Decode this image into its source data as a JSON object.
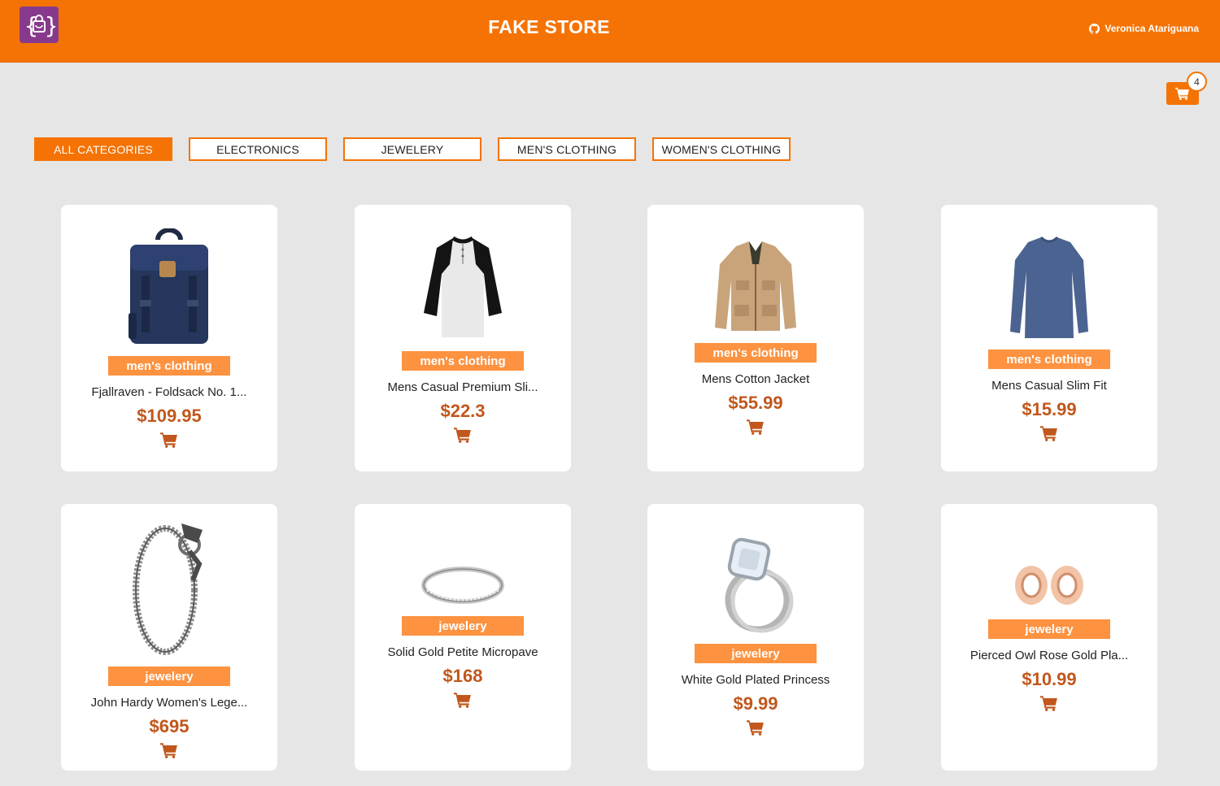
{
  "header": {
    "title": "FAKE STORE",
    "user_name": "Veronica Atariguana",
    "brand_color": "#f57304",
    "logo_color": "#873a8c"
  },
  "cart": {
    "count": "4"
  },
  "categories": [
    {
      "label": "ALL CATEGORIES",
      "active": true
    },
    {
      "label": "ELECTRONICS",
      "active": false
    },
    {
      "label": "JEWELERY",
      "active": false
    },
    {
      "label": "MEN'S CLOTHING",
      "active": false
    },
    {
      "label": "WOMEN'S CLOTHING",
      "active": false
    }
  ],
  "products": [
    {
      "category": "men's clothing",
      "title": "Fjallraven - Foldsack No. 1...",
      "price": "$109.95",
      "image": "backpack"
    },
    {
      "category": "men's clothing",
      "title": "Mens Casual Premium Sli...",
      "price": "$22.3",
      "image": "raglan-shirt"
    },
    {
      "category": "men's clothing",
      "title": "Mens Cotton Jacket",
      "price": "$55.99",
      "image": "jacket"
    },
    {
      "category": "men's clothing",
      "title": "Mens Casual Slim Fit",
      "price": "$15.99",
      "image": "longsleeve-shirt"
    },
    {
      "category": "jewelery",
      "title": "John Hardy Women's Lege...",
      "price": "$695",
      "image": "dragon-bracelet"
    },
    {
      "category": "jewelery",
      "title": "Solid Gold Petite Micropave",
      "price": "$168",
      "image": "ring-band"
    },
    {
      "category": "jewelery",
      "title": "White Gold Plated Princess",
      "price": "$9.99",
      "image": "engagement-ring"
    },
    {
      "category": "jewelery",
      "title": "Pierced Owl Rose Gold Pla...",
      "price": "$10.99",
      "image": "ear-plugs"
    }
  ]
}
